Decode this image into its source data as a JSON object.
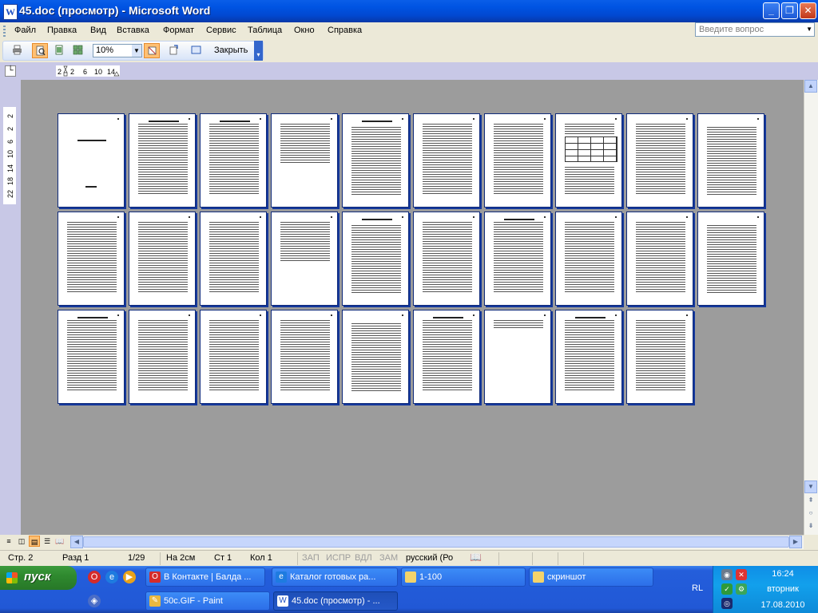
{
  "window": {
    "title": "45.doc (просмотр) - Microsoft Word",
    "icon": "word-doc-icon",
    "controls": {
      "minimize": "_",
      "maximize": "❐",
      "close": "✕"
    }
  },
  "menu": {
    "items": [
      "Файл",
      "Правка",
      "Вид",
      "Вставка",
      "Формат",
      "Сервис",
      "Таблица",
      "Окно",
      "Справка"
    ],
    "help_placeholder": "Введите вопрос"
  },
  "toolbar": {
    "zoom_value": "10%",
    "close_label": "Закрыть",
    "icons": [
      "print-icon",
      "magnifier-icon",
      "one-page-icon",
      "multiple-pages-icon",
      "zoom-select",
      "view-ruler-icon",
      "shrink-to-fit-icon",
      "full-screen-icon",
      "close-preview-button"
    ]
  },
  "ruler": {
    "horizontal_ticks": [
      "2",
      "2",
      "6",
      "10",
      "14"
    ],
    "vertical_ticks": [
      "2",
      "2",
      "6",
      "10",
      "14",
      "18",
      "22"
    ]
  },
  "document": {
    "pages_row1": 10,
    "pages_row2": 10,
    "pages_row3": 9
  },
  "status": {
    "page": "Стр. 2",
    "section": "Разд 1",
    "of": "1/29",
    "at": "На 2см",
    "line": "Ст 1",
    "col": "Кол 1",
    "rec": "ЗАП",
    "trk": "ИСПР",
    "ext": "ВДЛ",
    "ovr": "ЗАМ",
    "language": "русский (Ро"
  },
  "taskbar": {
    "start_label": "пуск",
    "row1": [
      {
        "label": "В Контакте | Балда ...",
        "icon": "opera-icon"
      },
      {
        "label": "Каталог готовых ра...",
        "icon": "ie-icon"
      },
      {
        "label": "1-100",
        "icon": "folder-icon"
      },
      {
        "label": "скриншот",
        "icon": "folder-icon"
      }
    ],
    "row2": [
      {
        "label": "50c.GIF - Paint",
        "icon": "paint-icon"
      },
      {
        "label": "45.doc (просмотр) - ...",
        "icon": "word-icon"
      }
    ],
    "lang": "RL",
    "time": "16:24",
    "day": "вторник",
    "date": "17.08.2010"
  }
}
